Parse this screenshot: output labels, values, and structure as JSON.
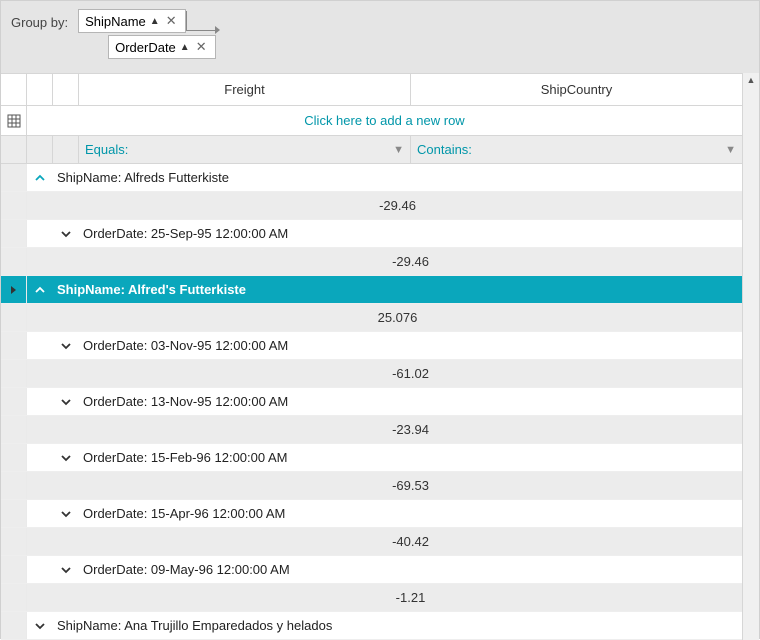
{
  "groupPanel": {
    "label": "Group by:",
    "chips": [
      {
        "field": "ShipName",
        "sort": "asc"
      },
      {
        "field": "OrderDate",
        "sort": "asc"
      }
    ]
  },
  "columns": {
    "freight": "Freight",
    "shipCountry": "ShipCountry"
  },
  "addNew": "Click here to add a new row",
  "filters": {
    "freight": "Equals:",
    "shipCountry": "Contains:"
  },
  "groups": [
    {
      "expanded": true,
      "label": "ShipName: Alfreds Futterkiste",
      "summary": "-29.46",
      "children": [
        {
          "expanded": false,
          "label": "OrderDate: 25-Sep-95 12:00:00 AM",
          "summary": "-29.46"
        }
      ]
    },
    {
      "expanded": true,
      "selected": true,
      "label": "ShipName: Alfred's Futterkiste",
      "summary": "25.076",
      "children": [
        {
          "expanded": false,
          "label": "OrderDate: 03-Nov-95 12:00:00 AM",
          "summary": "-61.02"
        },
        {
          "expanded": false,
          "label": "OrderDate: 13-Nov-95 12:00:00 AM",
          "summary": "-23.94"
        },
        {
          "expanded": false,
          "label": "OrderDate: 15-Feb-96 12:00:00 AM",
          "summary": "-69.53"
        },
        {
          "expanded": false,
          "label": "OrderDate: 15-Apr-96 12:00:00 AM",
          "summary": "-40.42"
        },
        {
          "expanded": false,
          "label": "OrderDate: 09-May-96 12:00:00 AM",
          "summary": "-1.21"
        }
      ]
    },
    {
      "expanded": false,
      "label": "ShipName: Ana Trujillo Emparedados y helados"
    }
  ]
}
